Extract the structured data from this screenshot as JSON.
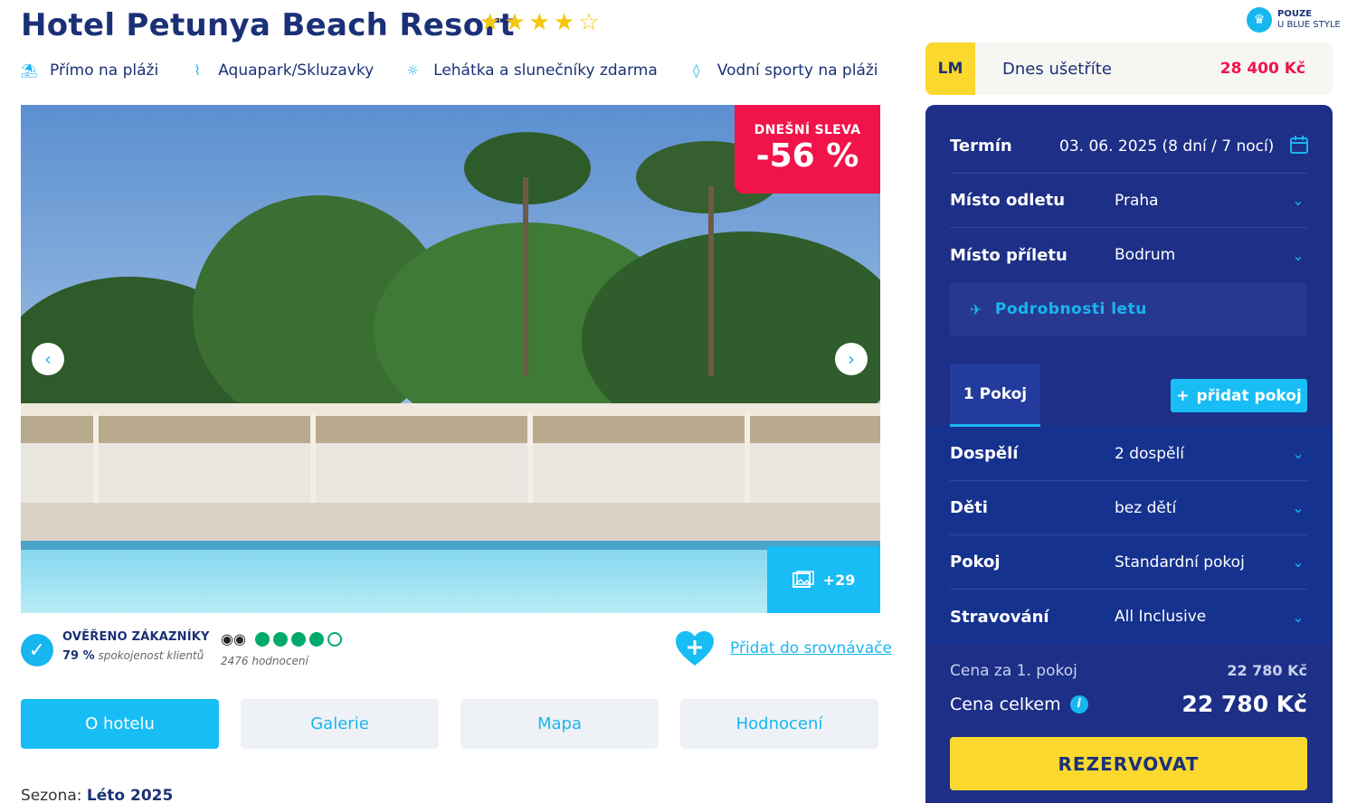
{
  "hotel": {
    "name": "Hotel Petunya Beach Resort",
    "stars": 4,
    "max_stars": 5
  },
  "features": [
    {
      "icon": "beach-icon",
      "label": "Přímo na pláži"
    },
    {
      "icon": "waterslide-icon",
      "label": "Aquapark/Skluzavky"
    },
    {
      "icon": "sunbed-icon",
      "label": "Lehátka a slunečníky zdarma"
    },
    {
      "icon": "surfboard-icon",
      "label": "Vodní sporty na pláži"
    }
  ],
  "gallery": {
    "discount_label": "DNEŠNÍ SLEVA",
    "discount_value": "-56 %",
    "more_photos": "+29"
  },
  "verified": {
    "title": "OVĚŘENO ZÁKAZNÍKY",
    "percent": "79 %",
    "percent_suffix": "spokojenost klientů"
  },
  "tripadvisor": {
    "rating": 4,
    "max": 5,
    "count_text": "2476 hodnocení"
  },
  "compare": {
    "label": "Přidat do srovnávače"
  },
  "tabs": [
    {
      "label": "O hotelu",
      "active": true
    },
    {
      "label": "Galerie",
      "active": false
    },
    {
      "label": "Mapa",
      "active": false
    },
    {
      "label": "Hodnocení",
      "active": false
    }
  ],
  "season": {
    "label": "Sezona:",
    "value": "Léto 2025"
  },
  "blue_style": {
    "line1": "POUZE",
    "line2": "U BLUE STYLE"
  },
  "last_minute": {
    "tag": "LM",
    "text": "Dnes ušetříte",
    "amount": "28 400 Kč"
  },
  "booking": {
    "term_label": "Termín",
    "term_value": "03. 06. 2025 (8 dní / 7 nocí)",
    "departure_label": "Místo odletu",
    "departure_value": "Praha",
    "arrival_label": "Místo příletu",
    "arrival_value": "Bodrum",
    "flight_details": "Podrobnosti letu",
    "room_tab": "1 Pokoj",
    "add_room": "přidat pokoj",
    "adults_label": "Dospělí",
    "adults_value": "2 dospělí",
    "children_label": "Děti",
    "children_value": "bez dětí",
    "room_label": "Pokoj",
    "room_value": "Standardní pokoj",
    "board_label": "Stravování",
    "board_value": "All Inclusive",
    "price_per_room_label": "Cena za 1. pokoj",
    "price_per_room": "22 780 Kč",
    "price_total_label": "Cena celkem",
    "price_total": "22 780 Kč",
    "reserve_label": "REZERVOVAT"
  },
  "colors": {
    "brand_blue": "#1d2f87",
    "accent_cyan": "#18bdf5",
    "discount_red": "#f0144b",
    "cta_yellow": "#fad82e",
    "tripadvisor_green": "#00aa6c"
  }
}
